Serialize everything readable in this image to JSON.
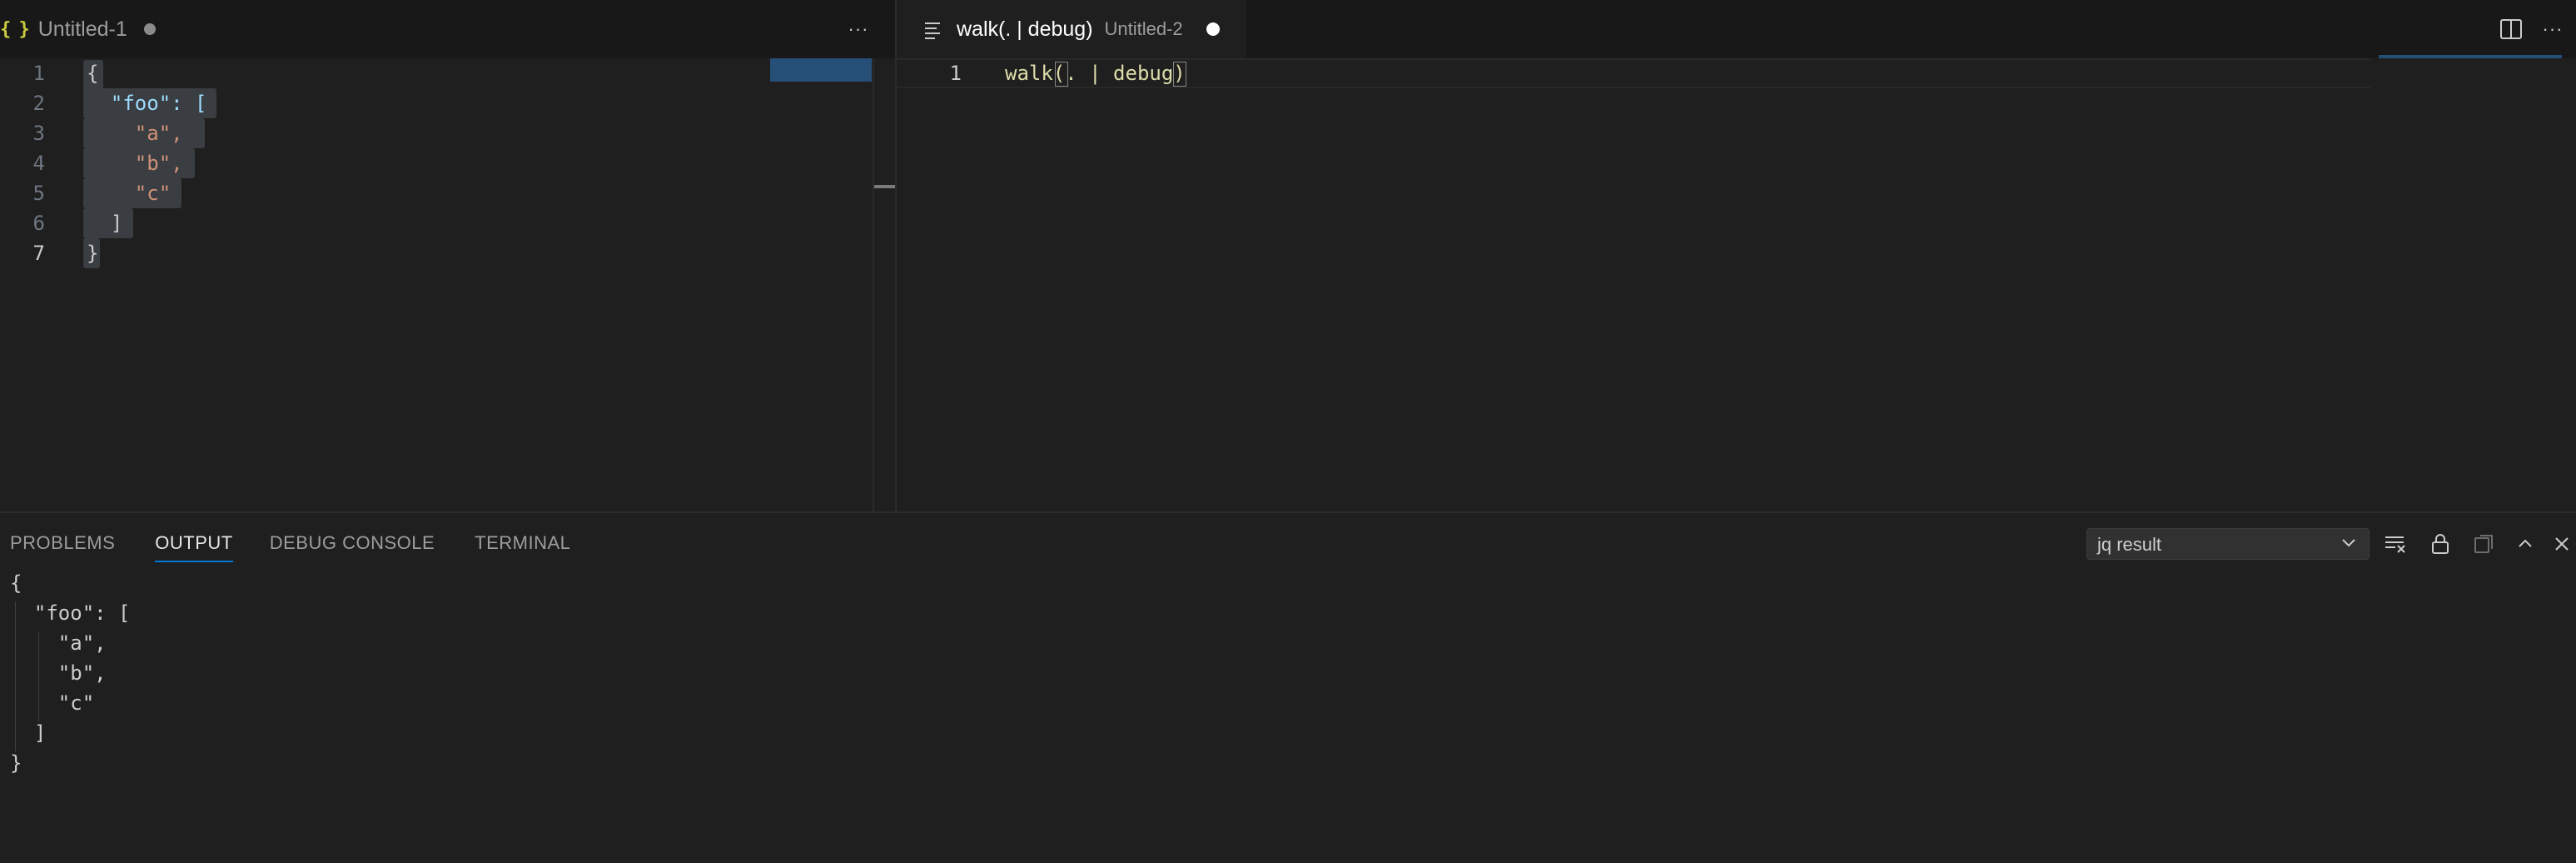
{
  "left_editor": {
    "tab_title": "Untitled-1",
    "tab_icon": "json-braces-icon",
    "more_actions": "···",
    "line_numbers": [
      "1",
      "2",
      "3",
      "4",
      "5",
      "6",
      "7"
    ],
    "lines": [
      "{",
      "  \"foo\": [",
      "    \"a\",",
      "    \"b\",",
      "    \"c\"",
      "  ]",
      "}"
    ]
  },
  "right_editor": {
    "tab_title": "walk(. | debug)",
    "tab_description": "Untitled-2",
    "line_numbers": [
      "1"
    ],
    "lines": [
      "walk(. | debug)"
    ],
    "more_actions": "···"
  },
  "panel": {
    "tabs": [
      "PROBLEMS",
      "OUTPUT",
      "DEBUG CONSOLE",
      "TERMINAL"
    ],
    "active_tab": "OUTPUT",
    "channel_select": "jq result",
    "output_lines": [
      "{",
      "  \"foo\": [",
      "    \"a\",",
      "    \"b\",",
      "    \"c\"",
      "  ]",
      "}"
    ]
  },
  "colors": {
    "background": "#1f1f1f",
    "tab_bar": "#181818",
    "accent": "#0078d4",
    "string": "#ce9178",
    "key": "#9cdcfe",
    "function": "#dcdcaa"
  }
}
